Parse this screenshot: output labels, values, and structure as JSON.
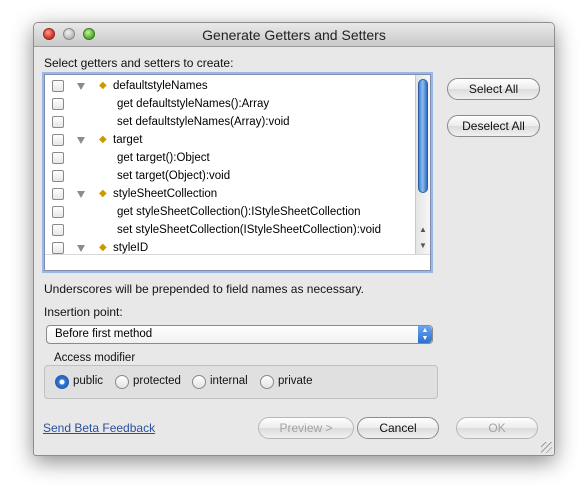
{
  "window": {
    "title": "Generate Getters and Setters"
  },
  "list": {
    "heading": "Select getters and setters to create:",
    "rows": [
      {
        "kind": "field",
        "text": "defaultstyleNames"
      },
      {
        "kind": "method",
        "text": "get defaultstyleNames():Array"
      },
      {
        "kind": "method",
        "text": "set defaultstyleNames(Array):void"
      },
      {
        "kind": "field",
        "text": "target"
      },
      {
        "kind": "method",
        "text": "get target():Object"
      },
      {
        "kind": "method",
        "text": "set target(Object):void"
      },
      {
        "kind": "field",
        "text": "styleSheetCollection"
      },
      {
        "kind": "method",
        "text": "get styleSheetCollection():IStyleSheetCollection"
      },
      {
        "kind": "method",
        "text": "set styleSheetCollection(IStyleSheetCollection):void"
      },
      {
        "kind": "field",
        "text": "styleID"
      }
    ],
    "scroll_up_icon": "triangle-up",
    "scroll_down_icon": "triangle-down"
  },
  "side_buttons": {
    "select_all": "Select All",
    "deselect_all": "Deselect All"
  },
  "hint": "Underscores will be prepended to field names as necessary.",
  "insertion": {
    "label": "Insertion point:",
    "selected": "Before first method"
  },
  "access": {
    "label": "Access modifier",
    "options": [
      {
        "label": "public",
        "checked": true
      },
      {
        "label": "protected",
        "checked": false
      },
      {
        "label": "internal",
        "checked": false
      },
      {
        "label": "private",
        "checked": false
      }
    ]
  },
  "footer": {
    "feedback_link": "Send Beta Feedback",
    "preview": "Preview >",
    "cancel": "Cancel",
    "ok": "OK"
  },
  "colors": {
    "selection_accent": "#2f76d6",
    "field_diamond": "#c79a00",
    "link": "#2a4f9e"
  }
}
